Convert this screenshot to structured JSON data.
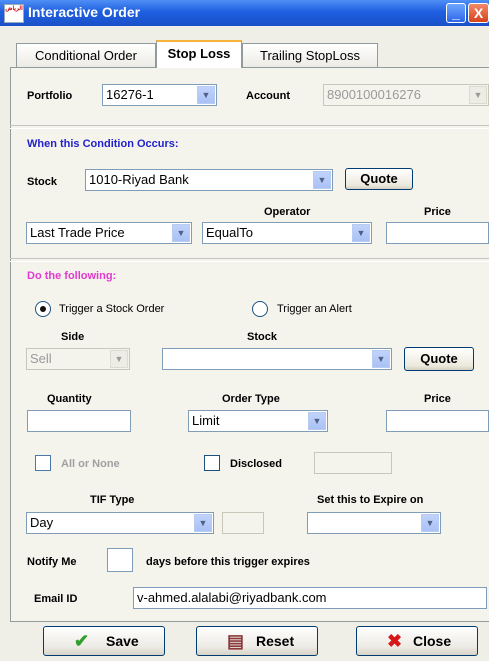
{
  "window": {
    "title": "Interactive Order",
    "minimize_glyph": "_",
    "close_glyph": "X",
    "icon_text": "الرياض"
  },
  "tabs": [
    {
      "label": "Conditional Order"
    },
    {
      "label": "Stop Loss"
    },
    {
      "label": "Trailing StopLoss"
    }
  ],
  "header": {
    "portfolio_label": "Portfolio",
    "portfolio_value": "16276-1",
    "account_label": "Account",
    "account_value": "8900100016276"
  },
  "condition": {
    "heading": "When this Condition Occurs:",
    "stock_label": "Stock",
    "stock_value": "1010-Riyad Bank",
    "quote_label": "Quote",
    "operator_label": "Operator",
    "price_label": "Price",
    "field_value": "Last Trade Price",
    "operator_value": "EqualTo",
    "price_value": ""
  },
  "action": {
    "heading": "Do the following:",
    "radio_stock_order": "Trigger a Stock Order",
    "radio_alert": "Trigger an Alert",
    "side_label": "Side",
    "side_value": "Sell",
    "stock_label": "Stock",
    "stock_value": "",
    "quote_label": "Quote",
    "quantity_label": "Quantity",
    "quantity_value": "",
    "order_type_label": "Order Type",
    "order_type_value": "Limit",
    "price_label": "Price",
    "price_value": "",
    "all_or_none_label": "All or None",
    "disclosed_label": "Disclosed",
    "disclosed_value": "",
    "tif_label": "TIF Type",
    "tif_value": "Day",
    "tif_days_value": "",
    "expire_label": "Set this to Expire on",
    "expire_value": "",
    "notify_label": "Notify Me",
    "notify_value": "",
    "notify_suffix": "days before this trigger expires",
    "email_label": "Email ID",
    "email_value": "v-ahmed.alalabi@riyadbank.com"
  },
  "buttons": {
    "save": "Save",
    "reset": "Reset",
    "close": "Close"
  },
  "icons": {
    "combo_arrow": "▼",
    "save_icon": "✔",
    "reset_icon": "▤",
    "close_icon": "✖"
  },
  "colors": {
    "titlebar": "#1f5fe0",
    "section_blue": "#2222cc",
    "section_pink": "#e03ad0",
    "save_check": "#2e9e2e",
    "close_x": "#d81818"
  }
}
